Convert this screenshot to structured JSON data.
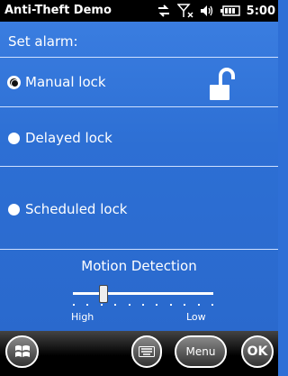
{
  "statusbar": {
    "app_title": "Anti-Theft Demo",
    "time": "5:00",
    "icons": [
      "data-sync-icon",
      "signal-off-icon",
      "volume-icon",
      "battery-icon"
    ]
  },
  "main": {
    "heading": "Set alarm:",
    "options": [
      {
        "label": "Manual lock",
        "selected": true
      },
      {
        "label": "Delayed lock",
        "selected": false
      },
      {
        "label": "Scheduled lock",
        "selected": false
      }
    ],
    "lock_icon": "unlocked-padlock-icon",
    "motion": {
      "title": "Motion Detection",
      "high_label": "High",
      "low_label": "Low",
      "level": 0.2
    }
  },
  "softkeys": {
    "start_icon": "windows-start-icon",
    "keyboard_icon": "keyboard-icon",
    "menu_label": "Menu",
    "ok_label": "OK"
  },
  "colors": {
    "background": "#2e6fd6",
    "statusbar": "#000000",
    "text": "#ffffff"
  }
}
